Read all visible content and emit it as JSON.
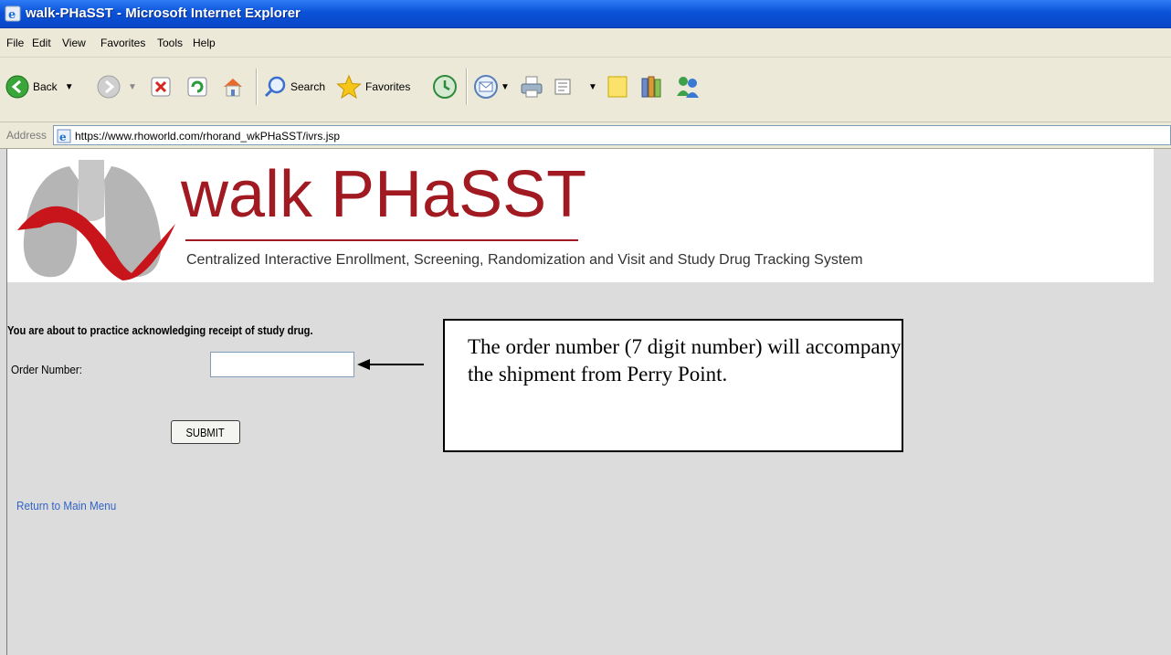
{
  "window": {
    "title": "walk-PHaSST - Microsoft Internet Explorer"
  },
  "menu": [
    "File",
    "Edit",
    "View",
    "Favorites",
    "Tools",
    "Help"
  ],
  "toolbar": {
    "back_label": "Back",
    "search_label": "Search",
    "favorites_label": "Favorites"
  },
  "address": {
    "label": "Address",
    "url": "https://www.rhoworld.com/rhorand_wkPHaSST/ivrs.jsp"
  },
  "banner": {
    "title": "walk PHaSST",
    "subtitle": "Centralized Interactive Enrollment, Screening, Randomization and Visit and Study Drug Tracking System"
  },
  "form": {
    "prompt": "You are about to practice acknowledging receipt of study drug.",
    "order_label": "Order Number:",
    "order_value": "",
    "submit_label": "SUBMIT",
    "return_link": "Return to Main Menu"
  },
  "callout": {
    "text": "The order number (7 digit number) will accompany the shipment from Perry Point."
  },
  "colors": {
    "brand_red": "#a11a22",
    "xp_title_blue": "#0a52d8",
    "link_blue": "#3264c8"
  }
}
